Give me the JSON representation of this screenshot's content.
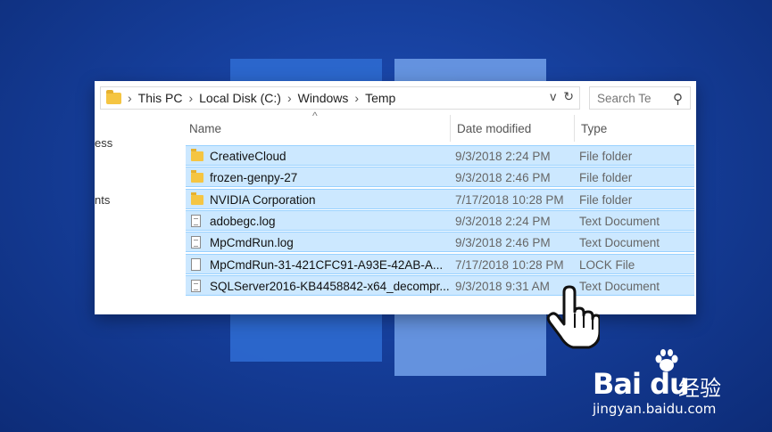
{
  "address": {
    "crumbs": [
      "This PC",
      "Local Disk (C:)",
      "Windows",
      "Temp"
    ],
    "dropdown_glyph": "v",
    "refresh_glyph": "↻"
  },
  "search": {
    "placeholder": "Search Te"
  },
  "nav": {
    "items": [
      "ess",
      "nts"
    ]
  },
  "columns": {
    "name": "Name",
    "date": "Date modified",
    "type": "Type"
  },
  "files": [
    {
      "name": "CreativeCloud",
      "date": "9/3/2018 2:24 PM",
      "type": "File folder",
      "icon": "folder-icon"
    },
    {
      "name": "frozen-genpy-27",
      "date": "9/3/2018 2:46 PM",
      "type": "File folder",
      "icon": "folder-icon"
    },
    {
      "name": "NVIDIA Corporation",
      "date": "7/17/2018 10:28 PM",
      "type": "File folder",
      "icon": "folder-icon"
    },
    {
      "name": "adobegc.log",
      "date": "9/3/2018 2:24 PM",
      "type": "Text Document",
      "icon": "text-document-icon"
    },
    {
      "name": "MpCmdRun.log",
      "date": "9/3/2018 2:46 PM",
      "type": "Text Document",
      "icon": "text-document-icon"
    },
    {
      "name": "MpCmdRun-31-421CFC91-A93E-42AB-A...",
      "date": "7/17/2018 10:28 PM",
      "type": "LOCK File",
      "icon": "blank-file-icon"
    },
    {
      "name": "SQLServer2016-KB4458842-x64_decompr...",
      "date": "9/3/2018 9:31 AM",
      "type": "Text Document",
      "icon": "text-document-icon"
    }
  ],
  "watermark": {
    "brand": "Bai du",
    "cn": "经验",
    "url": "jingyan.baidu.com"
  },
  "colors": {
    "selection": "#cce8ff",
    "selection_border": "#99d1ff",
    "background": "#163f9c"
  }
}
